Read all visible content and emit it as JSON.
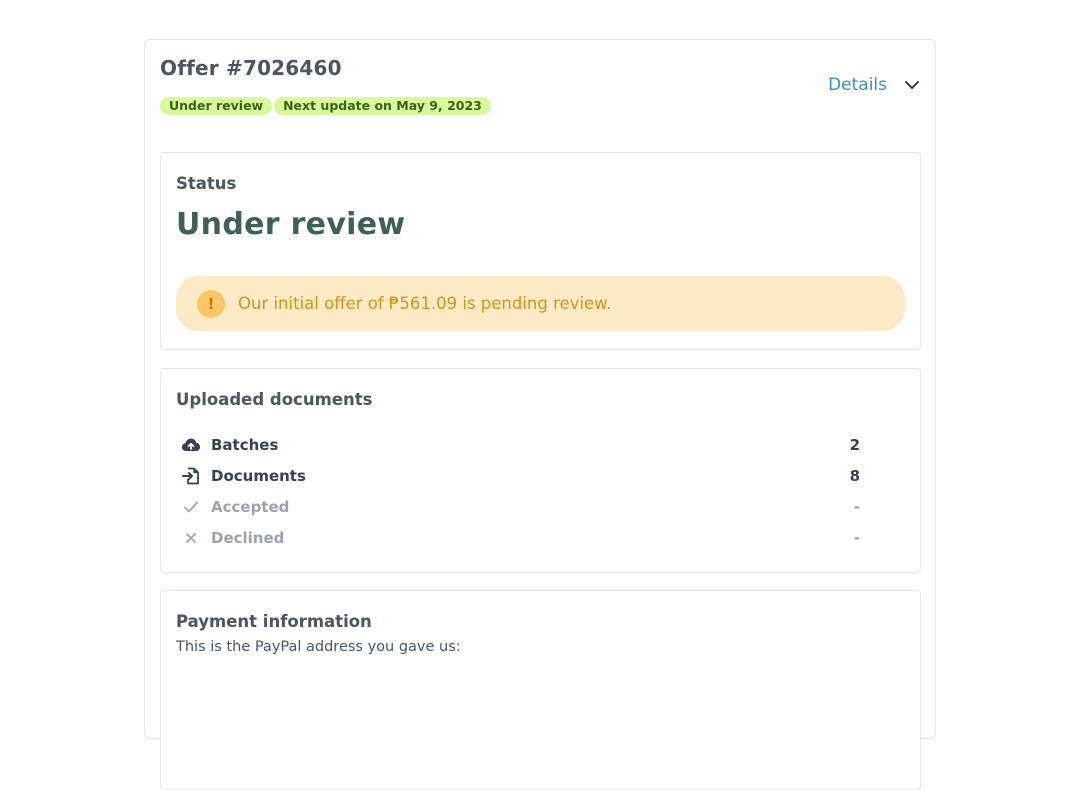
{
  "offer": {
    "title": "Offer #7026460",
    "badges": [
      "Under review",
      "Next update on May 9, 2023"
    ],
    "details_label": "Details"
  },
  "status": {
    "label": "Status",
    "value": "Under review",
    "alert_icon": "!",
    "alert_text": "Our initial offer of ₱561.09 is pending review."
  },
  "documents": {
    "title": "Uploaded documents",
    "rows": [
      {
        "label": "Batches",
        "count": "2",
        "icon": "cloud-upload-icon"
      },
      {
        "label": "Documents",
        "count": "8",
        "icon": "file-import-icon"
      },
      {
        "label": "Accepted",
        "count": "-",
        "icon": "check-icon"
      },
      {
        "label": "Declined",
        "count": "-",
        "icon": "x-icon"
      }
    ]
  },
  "payment": {
    "title": "Payment information",
    "description": "This is the PayPal address you gave us:"
  },
  "colors": {
    "badge_bg": "#d9f99d",
    "accent_link": "#3b8fbd",
    "status_value": "#3f5f58",
    "alert_bg": "#fdebc8",
    "alert_text": "#d69412"
  }
}
